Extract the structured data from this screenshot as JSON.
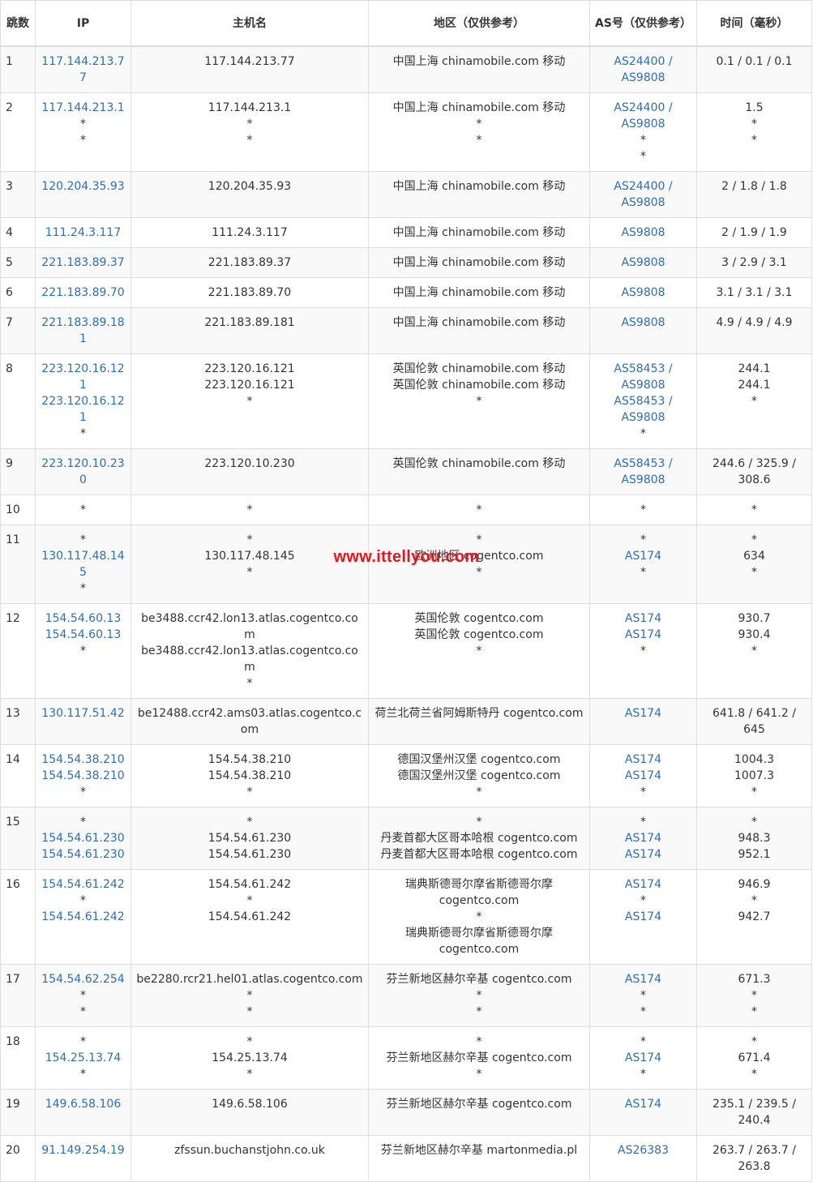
{
  "headers": [
    "跳数",
    "IP",
    "主机名",
    "地区（仅供参考）",
    "AS号（仅供参考）",
    "时间（毫秒）"
  ],
  "watermark": "www.ittellyou.com",
  "link_color": "#2c6fb3",
  "watermark_color": "#e8131d",
  "rows": [
    {
      "hop": "1",
      "ip": [
        "117.144.213.77"
      ],
      "host": [
        "117.144.213.77"
      ],
      "region": [
        "中国上海 chinamobile.com 移动"
      ],
      "asn": [
        "AS24400 / AS9808"
      ],
      "time": [
        "0.1 / 0.1 / 0.1"
      ]
    },
    {
      "hop": "2",
      "ip": [
        "117.144.213.1",
        "*",
        "*"
      ],
      "host": [
        "117.144.213.1",
        "*",
        "*"
      ],
      "region": [
        "中国上海 chinamobile.com 移动",
        "*",
        "*"
      ],
      "asn": [
        "AS24400 / AS9808",
        "*",
        "*"
      ],
      "time": [
        "1.5",
        "*",
        "*"
      ]
    },
    {
      "hop": "3",
      "ip": [
        "120.204.35.93"
      ],
      "host": [
        "120.204.35.93"
      ],
      "region": [
        "中国上海 chinamobile.com 移动"
      ],
      "asn": [
        "AS24400 / AS9808"
      ],
      "time": [
        "2 / 1.8 / 1.8"
      ]
    },
    {
      "hop": "4",
      "ip": [
        "111.24.3.117"
      ],
      "host": [
        "111.24.3.117"
      ],
      "region": [
        "中国上海 chinamobile.com 移动"
      ],
      "asn": [
        "AS9808"
      ],
      "time": [
        "2 / 1.9 / 1.9"
      ]
    },
    {
      "hop": "5",
      "ip": [
        "221.183.89.37"
      ],
      "host": [
        "221.183.89.37"
      ],
      "region": [
        "中国上海 chinamobile.com 移动"
      ],
      "asn": [
        "AS9808"
      ],
      "time": [
        "3 / 2.9 / 3.1"
      ]
    },
    {
      "hop": "6",
      "ip": [
        "221.183.89.70"
      ],
      "host": [
        "221.183.89.70"
      ],
      "region": [
        "中国上海 chinamobile.com 移动"
      ],
      "asn": [
        "AS9808"
      ],
      "time": [
        "3.1 / 3.1 / 3.1"
      ]
    },
    {
      "hop": "7",
      "ip": [
        "221.183.89.181"
      ],
      "host": [
        "221.183.89.181"
      ],
      "region": [
        "中国上海 chinamobile.com 移动"
      ],
      "asn": [
        "AS9808"
      ],
      "time": [
        "4.9 / 4.9 / 4.9"
      ]
    },
    {
      "hop": "8",
      "ip": [
        "223.120.16.121",
        "223.120.16.121",
        "*"
      ],
      "host": [
        "223.120.16.121",
        "223.120.16.121",
        "*"
      ],
      "region": [
        "英国伦敦 chinamobile.com 移动",
        "英国伦敦 chinamobile.com 移动",
        "*"
      ],
      "asn": [
        "AS58453 / AS9808",
        "AS58453 / AS9808",
        "*"
      ],
      "time": [
        "244.1",
        "244.1",
        "*"
      ]
    },
    {
      "hop": "9",
      "ip": [
        "223.120.10.230"
      ],
      "host": [
        "223.120.10.230"
      ],
      "region": [
        "英国伦敦 chinamobile.com 移动"
      ],
      "asn": [
        "AS58453 / AS9808"
      ],
      "time": [
        "244.6 / 325.9 / 308.6"
      ]
    },
    {
      "hop": "10",
      "ip": [
        "*"
      ],
      "host": [
        "*"
      ],
      "region": [
        "*"
      ],
      "asn": [
        "*"
      ],
      "time": [
        "*"
      ]
    },
    {
      "hop": "11",
      "ip": [
        "*",
        "130.117.48.145",
        "*"
      ],
      "host": [
        "*",
        "130.117.48.145",
        "*"
      ],
      "region": [
        "*",
        "欧洲地区 cogentco.com",
        "*"
      ],
      "asn": [
        "*",
        "AS174",
        "*"
      ],
      "time": [
        "*",
        "634",
        "*"
      ]
    },
    {
      "hop": "12",
      "ip": [
        "154.54.60.13",
        "154.54.60.13",
        "*"
      ],
      "host": [
        "be3488.ccr42.lon13.atlas.cogentco.com",
        "be3488.ccr42.lon13.atlas.cogentco.com",
        "*"
      ],
      "region": [
        "英国伦敦 cogentco.com",
        "英国伦敦 cogentco.com",
        "*"
      ],
      "asn": [
        "AS174",
        "AS174",
        "*"
      ],
      "time": [
        "930.7",
        "930.4",
        "*"
      ]
    },
    {
      "hop": "13",
      "ip": [
        "130.117.51.42"
      ],
      "host": [
        "be12488.ccr42.ams03.atlas.cogentco.com"
      ],
      "region": [
        "荷兰北荷兰省阿姆斯特丹 cogentco.com"
      ],
      "asn": [
        "AS174"
      ],
      "time": [
        "641.8 / 641.2 / 645"
      ]
    },
    {
      "hop": "14",
      "ip": [
        "154.54.38.210",
        "154.54.38.210",
        "*"
      ],
      "host": [
        "154.54.38.210",
        "154.54.38.210",
        "*"
      ],
      "region": [
        "德国汉堡州汉堡 cogentco.com",
        "德国汉堡州汉堡 cogentco.com",
        "*"
      ],
      "asn": [
        "AS174",
        "AS174",
        "*"
      ],
      "time": [
        "1004.3",
        "1007.3",
        "*"
      ]
    },
    {
      "hop": "15",
      "ip": [
        "*",
        "154.54.61.230",
        "154.54.61.230"
      ],
      "host": [
        "*",
        "154.54.61.230",
        "154.54.61.230"
      ],
      "region": [
        "*",
        "丹麦首都大区哥本哈根 cogentco.com",
        "丹麦首都大区哥本哈根 cogentco.com"
      ],
      "asn": [
        "*",
        "AS174",
        "AS174"
      ],
      "time": [
        "*",
        "948.3",
        "952.1"
      ]
    },
    {
      "hop": "16",
      "ip": [
        "154.54.61.242",
        "*",
        "154.54.61.242"
      ],
      "host": [
        "154.54.61.242",
        "*",
        "154.54.61.242"
      ],
      "region": [
        "瑞典斯德哥尔摩省斯德哥尔摩 cogentco.com",
        "*",
        "瑞典斯德哥尔摩省斯德哥尔摩 cogentco.com"
      ],
      "asn": [
        "AS174",
        "*",
        "AS174"
      ],
      "time": [
        "946.9",
        "*",
        "942.7"
      ]
    },
    {
      "hop": "17",
      "ip": [
        "154.54.62.254",
        "*",
        "*"
      ],
      "host": [
        "be2280.rcr21.hel01.atlas.cogentco.com",
        "*",
        "*"
      ],
      "region": [
        "芬兰新地区赫尔辛基 cogentco.com",
        "*",
        "*"
      ],
      "asn": [
        "AS174",
        "*",
        "*"
      ],
      "time": [
        "671.3",
        "*",
        "*"
      ]
    },
    {
      "hop": "18",
      "ip": [
        "*",
        "154.25.13.74",
        "*"
      ],
      "host": [
        "*",
        "154.25.13.74",
        "*"
      ],
      "region": [
        "*",
        "芬兰新地区赫尔辛基 cogentco.com",
        "*"
      ],
      "asn": [
        "*",
        "AS174",
        "*"
      ],
      "time": [
        "*",
        "671.4",
        "*"
      ]
    },
    {
      "hop": "19",
      "ip": [
        "149.6.58.106"
      ],
      "host": [
        "149.6.58.106"
      ],
      "region": [
        "芬兰新地区赫尔辛基 cogentco.com"
      ],
      "asn": [
        "AS174"
      ],
      "time": [
        "235.1 / 239.5 / 240.4"
      ]
    },
    {
      "hop": "20",
      "ip": [
        "91.149.254.19"
      ],
      "host": [
        "zfssun.buchanstjohn.co.uk"
      ],
      "region": [
        "芬兰新地区赫尔辛基 martonmedia.pl"
      ],
      "asn": [
        "AS26383"
      ],
      "time": [
        "263.7 / 263.7 / 263.8"
      ]
    }
  ]
}
